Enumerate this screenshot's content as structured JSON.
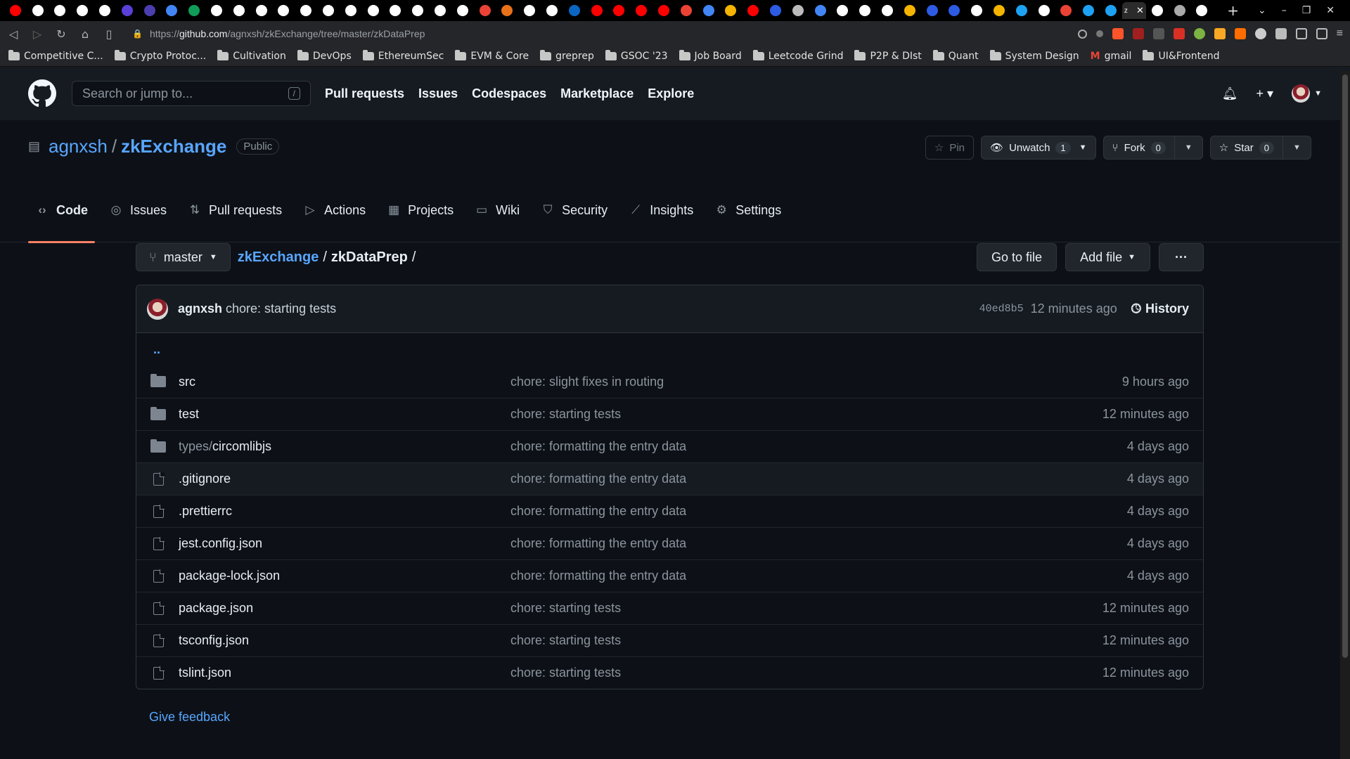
{
  "browser": {
    "url_prefix": "https://",
    "url_host": "github.com",
    "url_path": "/agnxsh/zkExchange/tree/master/zkDataPrep",
    "active_tab_letter": "z",
    "bookmarks": [
      "Competitive C...",
      "Crypto Protoc...",
      "Cultivation",
      "DevOps",
      "EthereumSec",
      "EVM & Core",
      "greprep",
      "GSOC '23",
      "Job Board",
      "Leetcode Grind",
      "P2P & DIst",
      "Quant",
      "System Design",
      "gmail",
      "UI&Frontend"
    ]
  },
  "header": {
    "search_placeholder": "Search or jump to...",
    "search_key": "/",
    "nav": [
      "Pull requests",
      "Issues",
      "Codespaces",
      "Marketplace",
      "Explore"
    ]
  },
  "repo": {
    "owner": "agnxsh",
    "separator": "/",
    "name": "zkExchange",
    "visibility": "Public",
    "pin_label": "Pin",
    "watch_label": "Unwatch",
    "watch_count": "1",
    "fork_label": "Fork",
    "fork_count": "0",
    "star_label": "Star",
    "star_count": "0",
    "tabs": [
      {
        "label": "Code",
        "icon": "code-icon"
      },
      {
        "label": "Issues",
        "icon": "issue-icon"
      },
      {
        "label": "Pull requests",
        "icon": "pull-request-icon"
      },
      {
        "label": "Actions",
        "icon": "play-icon"
      },
      {
        "label": "Projects",
        "icon": "table-icon"
      },
      {
        "label": "Wiki",
        "icon": "book-icon"
      },
      {
        "label": "Security",
        "icon": "shield-icon"
      },
      {
        "label": "Insights",
        "icon": "graph-icon"
      },
      {
        "label": "Settings",
        "icon": "gear-icon"
      }
    ]
  },
  "path": {
    "branch": "master",
    "root": "zkExchange",
    "sep1": "/",
    "dir": "zkDataPrep",
    "sep2": "/",
    "goto_label": "Go to file",
    "add_label": "Add file",
    "more_label": "···"
  },
  "commit": {
    "author": "agnxsh",
    "message": "chore: starting tests",
    "sha": "40ed8b5",
    "time": "12 minutes ago",
    "history_label": "History"
  },
  "parent_link": "..",
  "files": [
    {
      "type": "dir",
      "prefix": "",
      "name": "src",
      "message": "chore: slight fixes in routing",
      "time": "9 hours ago"
    },
    {
      "type": "dir",
      "prefix": "",
      "name": "test",
      "message": "chore: starting tests",
      "time": "12 minutes ago"
    },
    {
      "type": "dir",
      "prefix": "types/",
      "name": "circomlibjs",
      "message": "chore: formatting the entry data",
      "time": "4 days ago"
    },
    {
      "type": "file",
      "prefix": "",
      "name": ".gitignore",
      "message": "chore: formatting the entry data",
      "time": "4 days ago"
    },
    {
      "type": "file",
      "prefix": "",
      "name": ".prettierrc",
      "message": "chore: formatting the entry data",
      "time": "4 days ago"
    },
    {
      "type": "file",
      "prefix": "",
      "name": "jest.config.json",
      "message": "chore: formatting the entry data",
      "time": "4 days ago"
    },
    {
      "type": "file",
      "prefix": "",
      "name": "package-lock.json",
      "message": "chore: formatting the entry data",
      "time": "4 days ago"
    },
    {
      "type": "file",
      "prefix": "",
      "name": "package.json",
      "message": "chore: starting tests",
      "time": "12 minutes ago"
    },
    {
      "type": "file",
      "prefix": "",
      "name": "tsconfig.json",
      "message": "chore: starting tests",
      "time": "12 minutes ago"
    },
    {
      "type": "file",
      "prefix": "",
      "name": "tslint.json",
      "message": "chore: starting tests",
      "time": "12 minutes ago"
    }
  ],
  "feedback_label": "Give feedback",
  "colors": {
    "accent": "#58a6ff",
    "underline": "#f78166",
    "bg": "#0d1117"
  }
}
